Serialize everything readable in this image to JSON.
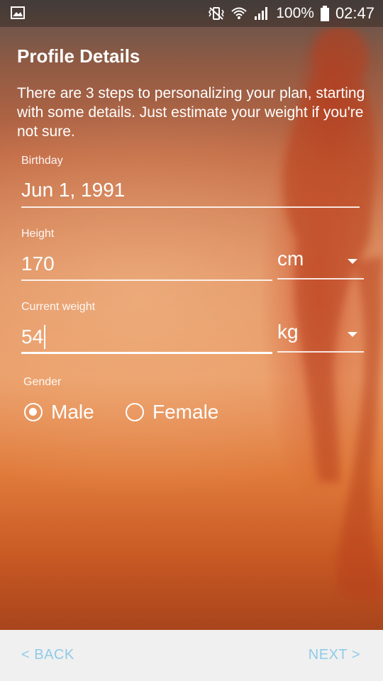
{
  "status_bar": {
    "battery_percent": "100%",
    "time": "02:47",
    "icons": [
      "image-icon",
      "vibrate-icon",
      "wifi-icon",
      "signal-icon",
      "battery-icon"
    ]
  },
  "header": {
    "title": "Profile Details",
    "intro": "There are 3 steps to personalizing your plan, starting with some details. Just estimate your weight if you're not sure."
  },
  "form": {
    "birthday": {
      "label": "Birthday",
      "value": "Jun 1, 1991"
    },
    "height": {
      "label": "Height",
      "value": "170",
      "unit": "cm"
    },
    "weight": {
      "label": "Current weight",
      "value": "54",
      "unit": "kg"
    },
    "gender": {
      "label": "Gender",
      "options": [
        "Male",
        "Female"
      ],
      "selected": "Male"
    }
  },
  "navigation": {
    "back_label": "< BACK",
    "next_label": "NEXT >"
  },
  "colors": {
    "nav_text": "#8fcbe8",
    "bottom_bar": "#f0f0f0"
  }
}
